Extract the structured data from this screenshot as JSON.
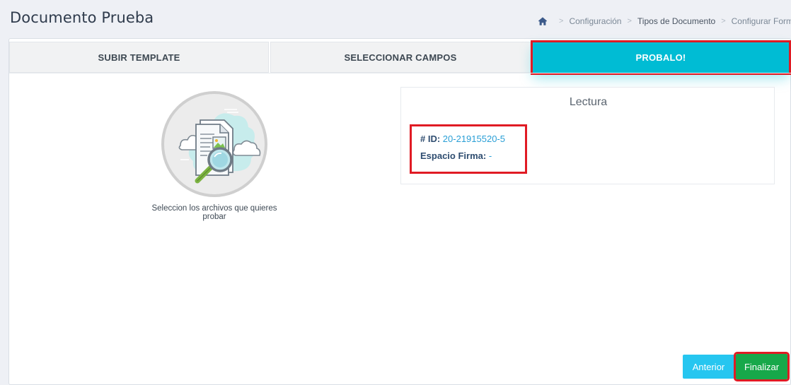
{
  "header": {
    "title": "Documento Prueba"
  },
  "breadcrumb": {
    "items": [
      {
        "label": "Configuración"
      },
      {
        "label": "Tipos de Documento"
      },
      {
        "label": "Configurar Formato"
      }
    ],
    "separator": ">"
  },
  "tabs": [
    {
      "label": "SUBIR TEMPLATE",
      "active": false
    },
    {
      "label": "SELECCIONAR CAMPOS",
      "active": false
    },
    {
      "label": "PROBALO!",
      "active": true
    }
  ],
  "upload": {
    "caption": "Seleccion los archivos que quieres probar",
    "icon": "document-search-icon"
  },
  "lectura": {
    "title": "Lectura",
    "fields": [
      {
        "label": "# ID:",
        "value": "20-21915520-5"
      },
      {
        "label": "Espacio Firma:",
        "value": "-"
      }
    ]
  },
  "actions": {
    "previous_label": "Anterior",
    "finish_label": "Finalizar"
  },
  "colors": {
    "accent": "#00bcd4",
    "highlight": "#e01b24",
    "finish": "#17a84a",
    "previous": "#26c6f0"
  }
}
